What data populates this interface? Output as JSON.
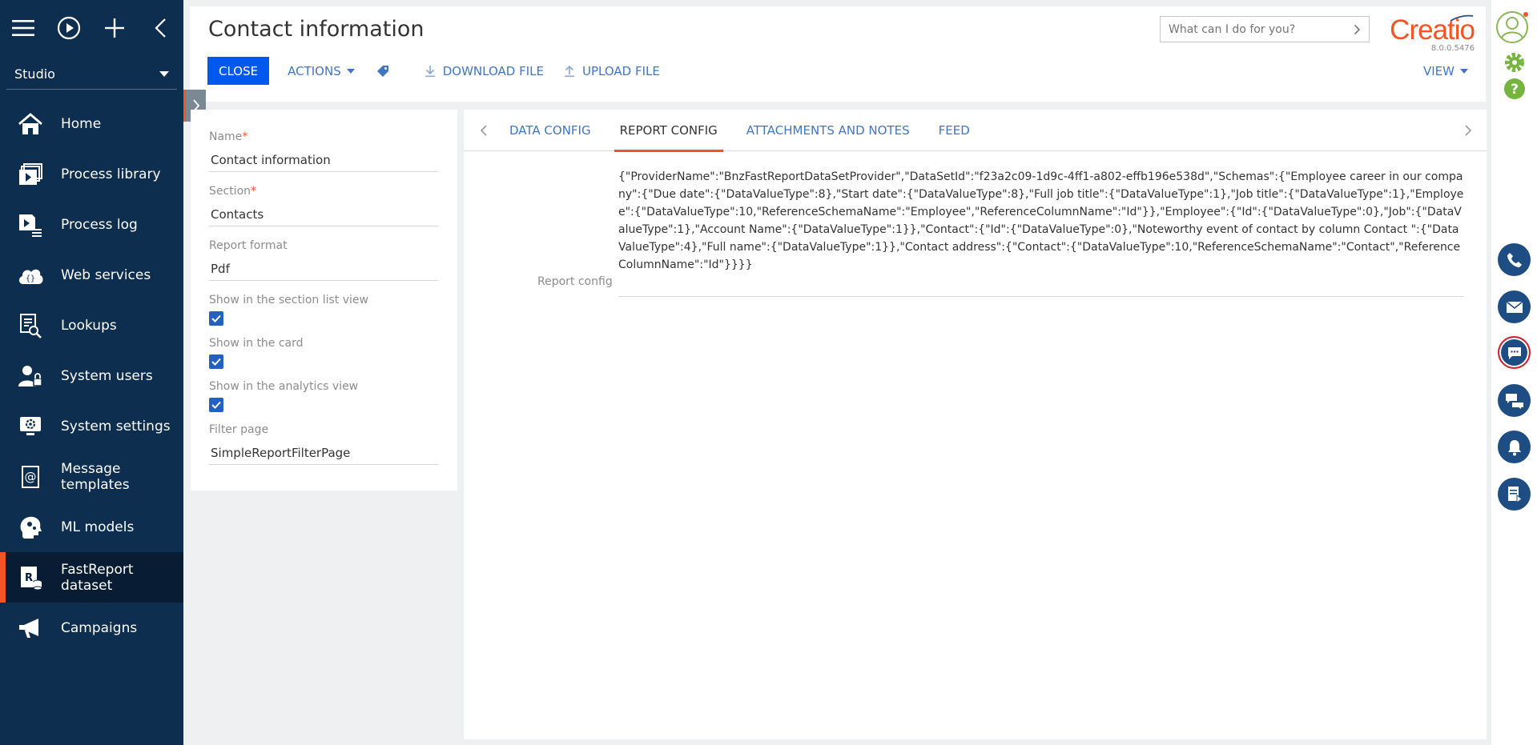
{
  "sidebar": {
    "workspace": "Studio",
    "items": [
      {
        "label": "Home",
        "icon": "home-icon",
        "active": false
      },
      {
        "label": "Process library",
        "icon": "process-library-icon",
        "active": false
      },
      {
        "label": "Process log",
        "icon": "process-log-icon",
        "active": false
      },
      {
        "label": "Web services",
        "icon": "cloud-icon",
        "active": false
      },
      {
        "label": "Lookups",
        "icon": "lookups-icon",
        "active": false
      },
      {
        "label": "System users",
        "icon": "users-icon",
        "active": false
      },
      {
        "label": "System settings",
        "icon": "settings-monitor-icon",
        "active": false
      },
      {
        "label": "Message templates",
        "icon": "message-templates-icon",
        "active": false
      },
      {
        "label": "ML models",
        "icon": "ml-models-icon",
        "active": false
      },
      {
        "label": "FastReport dataset",
        "icon": "fastreport-icon",
        "active": true
      },
      {
        "label": "Campaigns",
        "icon": "megaphone-icon",
        "active": false
      }
    ]
  },
  "header": {
    "title": "Contact information",
    "search_placeholder": "What can I do for you?",
    "logo": "Creatio",
    "version": "8.0.0.5476",
    "close_label": "CLOSE",
    "actions_label": "ACTIONS",
    "download_label": "DOWNLOAD FILE",
    "upload_label": "UPLOAD FILE",
    "view_label": "VIEW"
  },
  "form": {
    "name_label": "Name",
    "name_value": "Contact information",
    "section_label": "Section",
    "section_value": "Contacts",
    "format_label": "Report format",
    "format_value": "Pdf",
    "show_section_label": "Show in the section list view",
    "show_card_label": "Show in the card",
    "show_analytics_label": "Show in the analytics view",
    "filter_label": "Filter page",
    "filter_value": "SimpleReportFilterPage",
    "colors": {
      "accent": "#f25524",
      "brand": "#0058ef",
      "checkbox": "#2260c2"
    }
  },
  "tabs": {
    "items": [
      "DATA CONFIG",
      "REPORT CONFIG",
      "ATTACHMENTS AND NOTES",
      "FEED"
    ],
    "active": "REPORT CONFIG"
  },
  "report_config": {
    "label": "Report config",
    "value": "{\"ProviderName\":\"BnzFastReportDataSetProvider\",\"DataSetId\":\"f23a2c09-1d9c-4ff1-a802-effb196e538d\",\"Schemas\":{\"Employee career in our company\":{\"Due date\":{\"DataValueType\":8},\"Start date\":{\"DataValueType\":8},\"Full job title\":{\"DataValueType\":1},\"Job title\":{\"DataValueType\":1},\"Employee\":{\"DataValueType\":10,\"ReferenceSchemaName\":\"Employee\",\"ReferenceColumnName\":\"Id\"}},\"Employee\":{\"Id\":{\"DataValueType\":0},\"Job\":{\"DataValueType\":1},\"Account Name\":{\"DataValueType\":1}},\"Contact\":{\"Id\":{\"DataValueType\":0},\"Noteworthy event of contact by column Contact \":{\"DataValueType\":4},\"Full name\":{\"DataValueType\":1}},\"Contact address\":{\"Contact\":{\"DataValueType\":10,\"ReferenceSchemaName\":\"Contact\",\"ReferenceColumnName\":\"Id\"}}}}"
  }
}
